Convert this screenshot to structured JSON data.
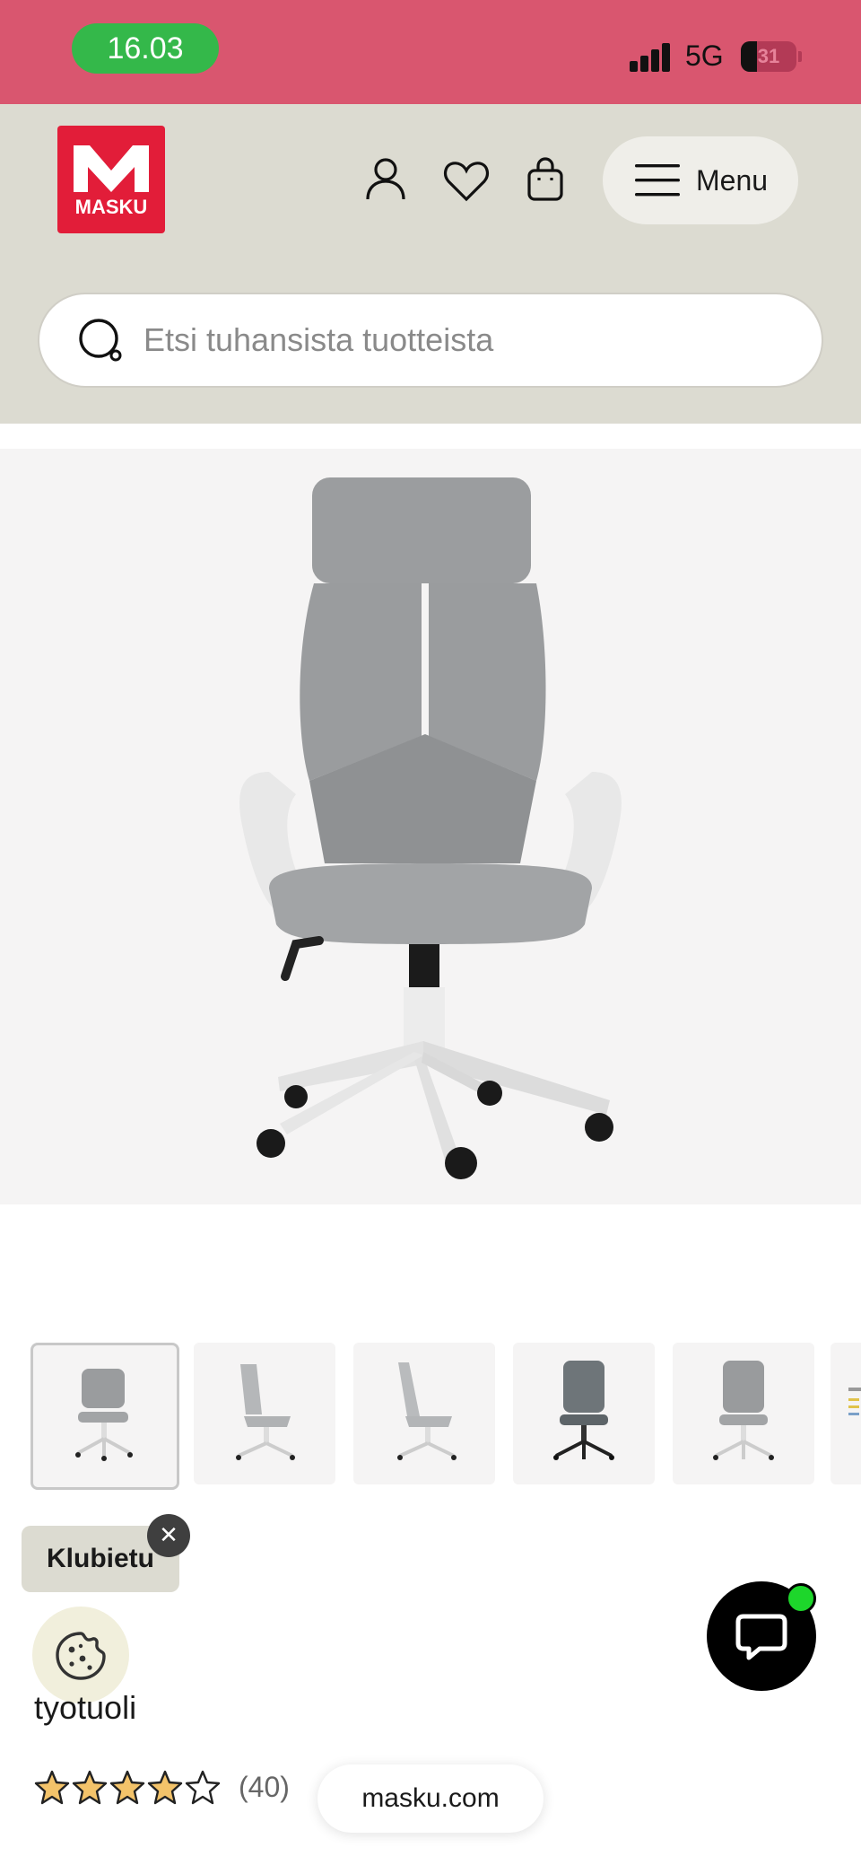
{
  "status_bar": {
    "time": "16.03",
    "network": "5G",
    "battery": "31",
    "battery_level": 0.31
  },
  "header": {
    "logo_text": "MASKU",
    "menu_label": "Menu",
    "icons": [
      "user-icon",
      "heart-icon",
      "bag-icon"
    ]
  },
  "search": {
    "placeholder": "Etsi tuhansista tuotteista"
  },
  "product": {
    "image_alt": "office chair",
    "thumbnail_count": 6,
    "title": "tyotuoli",
    "rating_stars": 4,
    "rating_max": 5,
    "review_count": "(40)"
  },
  "promo": {
    "label": "Klubietu"
  },
  "browser": {
    "domain": "masku.com"
  },
  "colors": {
    "status_bar": "#d9566f",
    "time_pill": "#34b84a",
    "header_bg": "#dcdbd1",
    "brand_red": "#e21d39",
    "star_fill": "#f3c36a",
    "chat_dot": "#1dd62b"
  }
}
